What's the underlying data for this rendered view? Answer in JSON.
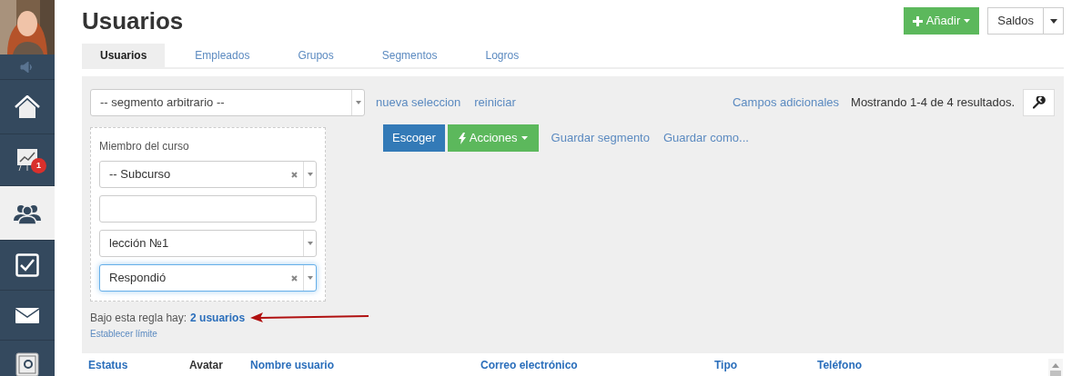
{
  "sidebar": {
    "items": [
      {
        "kind": "speaker",
        "selected": false
      },
      {
        "kind": "home",
        "selected": false
      },
      {
        "kind": "chart",
        "selected": false,
        "badge": "1"
      },
      {
        "kind": "users",
        "selected": true
      },
      {
        "kind": "tasks",
        "selected": false
      },
      {
        "kind": "mail",
        "selected": false
      },
      {
        "kind": "safe",
        "selected": false
      }
    ]
  },
  "title": "Usuarios",
  "header_buttons": {
    "add": "Añadir",
    "balances": "Saldos"
  },
  "tabs": [
    {
      "label": "Usuarios",
      "selected": true
    },
    {
      "label": "Empleados",
      "selected": false
    },
    {
      "label": "Grupos",
      "selected": false
    },
    {
      "label": "Segmentos",
      "selected": false
    },
    {
      "label": "Logros",
      "selected": false
    }
  ],
  "toolbar": {
    "segment_select": "-- segmento arbitrario --",
    "links": [
      "nueva seleccion",
      "reiniciar"
    ],
    "extra_fields_link": "Campos adicionales",
    "results": "Mostrando 1-4 de 4 resultados."
  },
  "filter": {
    "label": "Miembro del curso",
    "controls": [
      {
        "kind": "select",
        "value": "-- Subcurso",
        "clearable": true,
        "focused": false
      },
      {
        "kind": "input",
        "focused": false
      },
      {
        "kind": "select",
        "value": "lección №1",
        "clearable": false,
        "focused": false
      },
      {
        "kind": "select",
        "value": "Respondió",
        "clearable": true,
        "focused": true
      }
    ]
  },
  "actions": {
    "choose": "Escoger",
    "actions": "Acciones",
    "links": [
      "Guardar segmento",
      "Guardar como..."
    ]
  },
  "rule_summary": {
    "text": "Bajo esta regla hay:",
    "count_link": "2 usuarios",
    "limit_link": "Establecer límite"
  },
  "table": {
    "columns": [
      {
        "label": "Estatus",
        "sortable": true
      },
      {
        "label": "Avatar",
        "sortable": false
      },
      {
        "label": "Nombre usuario",
        "sortable": true
      },
      {
        "label": "Correo electrónico",
        "sortable": true
      },
      {
        "label": "Tipo",
        "sortable": true
      },
      {
        "label": "Teléfono",
        "sortable": true
      }
    ]
  }
}
